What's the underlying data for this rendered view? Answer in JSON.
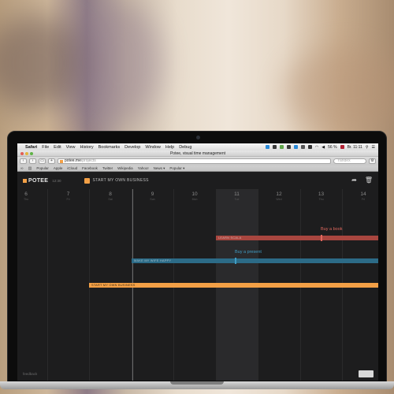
{
  "menubar": {
    "app": "Safari",
    "items": [
      "File",
      "Edit",
      "View",
      "History",
      "Bookmarks",
      "Develop",
      "Window",
      "Help",
      "Debug"
    ],
    "battery": "56 %",
    "clock": "Br. 11:11"
  },
  "browser": {
    "window_title": "Potee, visual time management",
    "url_host": "potee.me",
    "url_path": "/projects",
    "search_placeholder": "Yandex",
    "bookmarks": [
      "Popular",
      "Apple",
      "iCloud",
      "Facebook",
      "Twitter",
      "Wikipedia",
      "Yahoo!",
      "News ▾",
      "Popular ▾"
    ]
  },
  "app": {
    "logo": "POTEE",
    "time": "12:30",
    "project_title": "START MY OWN BUSINESS",
    "feedback": "feedback",
    "corner_button": "",
    "accent_color": "#f3a046"
  },
  "timeline": {
    "days": [
      {
        "num": "6",
        "dow": "Thu"
      },
      {
        "num": "7",
        "dow": "Fri"
      },
      {
        "num": "8",
        "dow": "Sat"
      },
      {
        "num": "9",
        "dow": "Sun"
      },
      {
        "num": "10",
        "dow": "Mon"
      },
      {
        "num": "11",
        "dow": "Tue"
      },
      {
        "num": "12",
        "dow": "Wed"
      },
      {
        "num": "13",
        "dow": "Thu"
      },
      {
        "num": "14",
        "dow": "Fri"
      }
    ],
    "tasks": [
      {
        "label": "LEARN SCALA",
        "color": "#a8463f",
        "milestone": "Buy a book",
        "milestone_color": "#e0685e"
      },
      {
        "label": "MAKE MY WIFE HAPPY",
        "color": "#2c6b87",
        "milestone": "Buy a present",
        "milestone_color": "#3f9cc4"
      },
      {
        "label": "START MY OWN BUSINESS",
        "color": "#f3a046",
        "milestone": "",
        "milestone_color": ""
      }
    ]
  }
}
